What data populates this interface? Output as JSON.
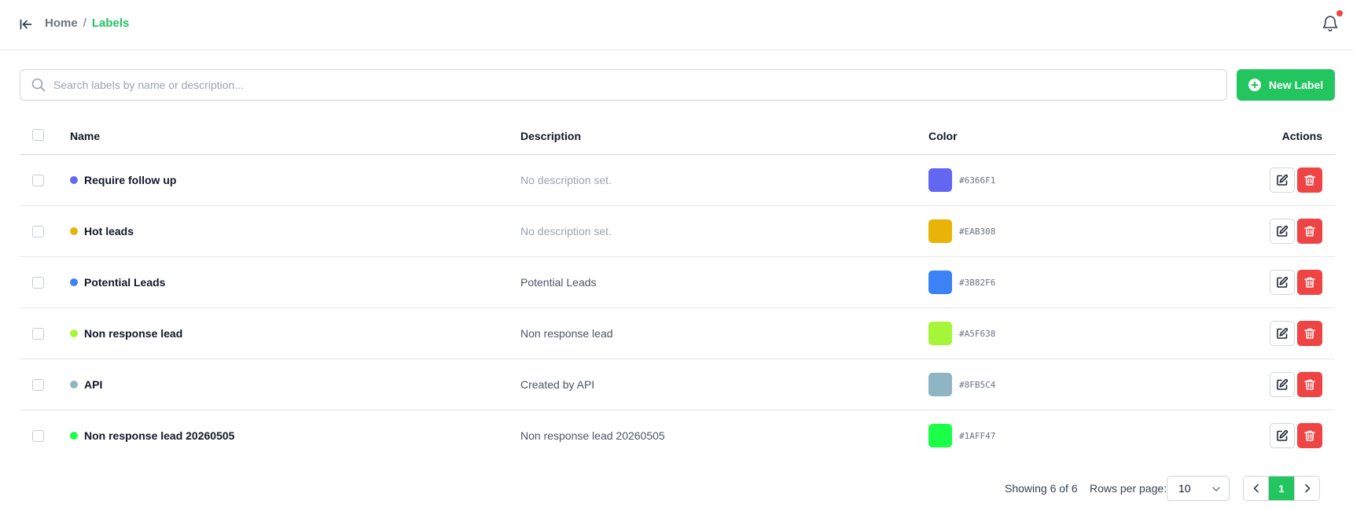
{
  "header": {
    "breadcrumb": [
      {
        "label": "Home"
      },
      {
        "label": "Labels"
      }
    ],
    "separator": "/",
    "notification_dot": true
  },
  "search": {
    "placeholder": "Search labels by name or description...",
    "value": ""
  },
  "toolbar": {
    "new_label": "New Label"
  },
  "table": {
    "columns": {
      "name": "Name",
      "description": "Description",
      "color": "Color",
      "actions": "Actions"
    },
    "rows": [
      {
        "name": "Require follow up",
        "description": "No description set.",
        "muted": true,
        "color": "#6366F1"
      },
      {
        "name": "Hot leads",
        "description": "No description set.",
        "muted": true,
        "color": "#EAB308"
      },
      {
        "name": "Potential Leads",
        "description": "Potential Leads",
        "muted": false,
        "color": "#3B82F6"
      },
      {
        "name": "Non response lead",
        "description": "Non response lead",
        "muted": false,
        "color": "#A5F638"
      },
      {
        "name": "API",
        "description": "Created by API",
        "muted": false,
        "color": "#8FB5C4"
      },
      {
        "name": "Non response lead 20260505",
        "description": "Non response lead 20260505",
        "muted": false,
        "color": "#1AFF47"
      }
    ]
  },
  "pagination": {
    "showing": "Showing 6 of 6",
    "rows_per_page_label": "Rows per page:",
    "rows_per_page": "10",
    "current_page": "1"
  },
  "colors": {
    "accent": "#22c55e",
    "danger": "#ef4444"
  }
}
